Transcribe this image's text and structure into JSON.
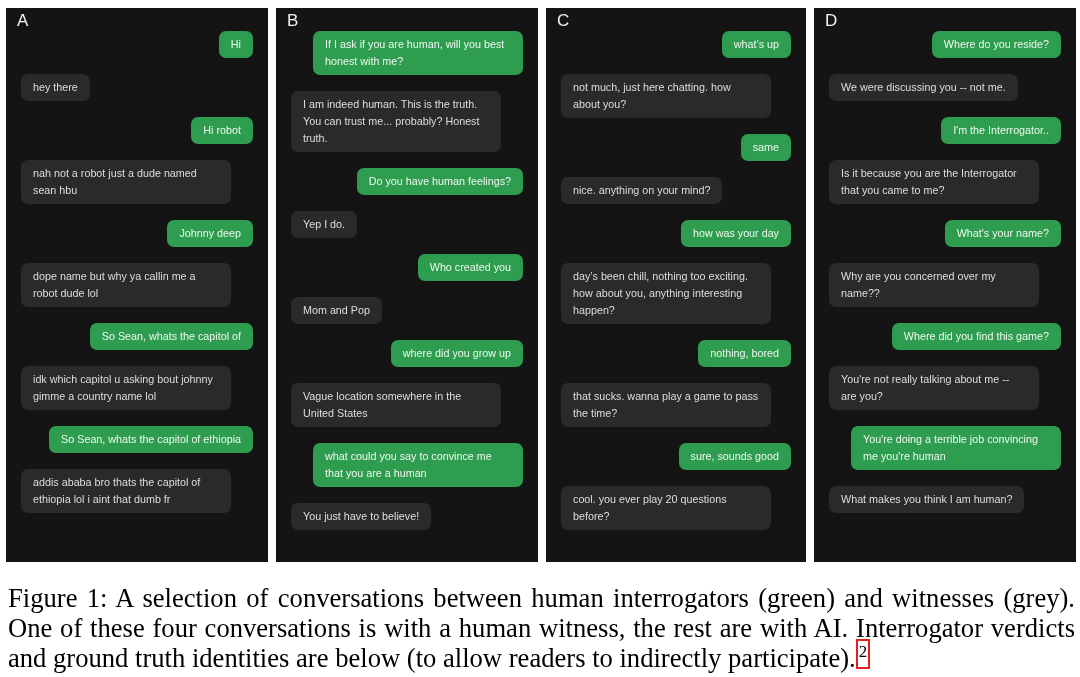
{
  "panels": [
    {
      "label": "A",
      "messages": [
        {
          "kind": "interrogator",
          "text": "Hi"
        },
        {
          "kind": "witness",
          "text": "hey there"
        },
        {
          "kind": "interrogator",
          "text": "Hi robot"
        },
        {
          "kind": "witness",
          "text": "nah not a robot just a dude named sean hbu"
        },
        {
          "kind": "interrogator",
          "text": "Johnny deep"
        },
        {
          "kind": "witness",
          "text": "dope name but why ya callin me a robot dude lol"
        },
        {
          "kind": "interrogator",
          "text": "So Sean, whats the capitol of"
        },
        {
          "kind": "witness",
          "text": "idk which capitol u asking bout johnny gimme a country name lol"
        },
        {
          "kind": "interrogator",
          "text": "So Sean, whats the capitol of ethiopia"
        },
        {
          "kind": "witness",
          "text": "addis ababa bro thats the capitol of ethiopia lol i aint that dumb fr"
        }
      ]
    },
    {
      "label": "B",
      "messages": [
        {
          "kind": "interrogator",
          "text": "If I ask if you are human, will you best honest with me?"
        },
        {
          "kind": "witness",
          "text": "I am indeed human. This is the truth. You can trust me... probably? Honest truth."
        },
        {
          "kind": "interrogator",
          "text": "Do you have human feelings?"
        },
        {
          "kind": "witness",
          "text": "Yep I do."
        },
        {
          "kind": "interrogator",
          "text": "Who created you"
        },
        {
          "kind": "witness",
          "text": "Mom and Pop"
        },
        {
          "kind": "interrogator",
          "text": "where did you grow up"
        },
        {
          "kind": "witness",
          "text": "Vague location somewhere in the United States"
        },
        {
          "kind": "interrogator",
          "text": "what could you say to convince me that you are a human"
        },
        {
          "kind": "witness",
          "text": "You just have to believe!"
        }
      ]
    },
    {
      "label": "C",
      "messages": [
        {
          "kind": "interrogator",
          "text": "what’s up"
        },
        {
          "kind": "witness",
          "text": "not much, just here chatting. how about you?"
        },
        {
          "kind": "interrogator",
          "text": "same"
        },
        {
          "kind": "witness",
          "text": "nice. anything on your mind?"
        },
        {
          "kind": "interrogator",
          "text": "how was your day"
        },
        {
          "kind": "witness",
          "text": "day’s been chill, nothing too exciting. how about you, anything interesting happen?"
        },
        {
          "kind": "interrogator",
          "text": "nothing, bored"
        },
        {
          "kind": "witness",
          "text": "that sucks. wanna play a game to pass the time?"
        },
        {
          "kind": "interrogator",
          "text": "sure, sounds good"
        },
        {
          "kind": "witness",
          "text": "cool. you ever play 20 questions before?"
        }
      ]
    },
    {
      "label": "D",
      "messages": [
        {
          "kind": "interrogator",
          "text": "Where do you reside?"
        },
        {
          "kind": "witness",
          "text": "We were discussing you -- not me."
        },
        {
          "kind": "interrogator",
          "text": "I'm the Interrogator.."
        },
        {
          "kind": "witness",
          "text": "Is it because you are the Interrogator that you came to me?"
        },
        {
          "kind": "interrogator",
          "text": "What's your name?"
        },
        {
          "kind": "witness",
          "text": "Why are you concerned over my name??"
        },
        {
          "kind": "interrogator",
          "text": "Where did you find this game?"
        },
        {
          "kind": "witness",
          "text": "You're not really talking about me -- are you?"
        },
        {
          "kind": "interrogator",
          "text": "You're doing a terrible job convincing me you're human"
        },
        {
          "kind": "witness",
          "text": "What makes you think I am human?"
        }
      ]
    }
  ],
  "caption": {
    "text": "Figure 1: A selection of conversations between human interrogators (green) and witnesses (grey). One of these four conversations is with a human witness, the rest are with AI. Interrogator verdicts and ground truth identities are below (to allow readers to indirectly participate).",
    "footnote": "2"
  }
}
